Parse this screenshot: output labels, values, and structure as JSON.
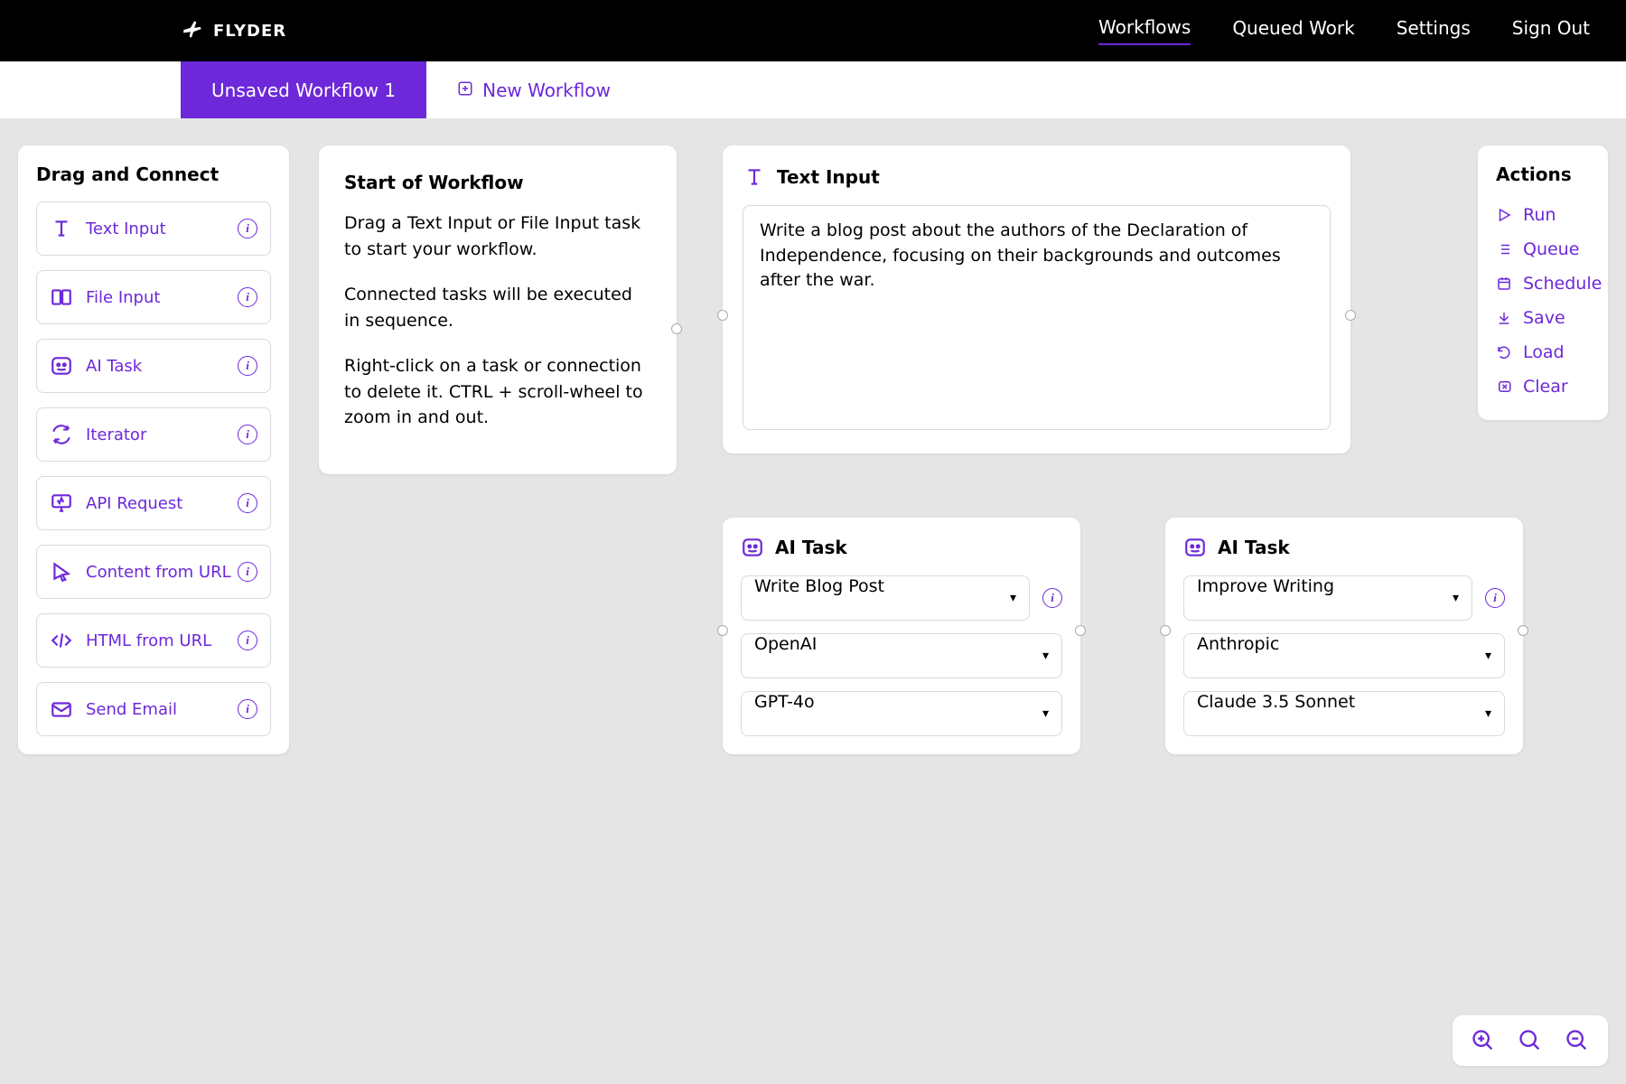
{
  "brand": "FLYDER",
  "nav": {
    "items": [
      "Workflows",
      "Queued Work",
      "Settings",
      "Sign Out"
    ],
    "active": 0
  },
  "tabs": {
    "active_label": "Unsaved Workflow 1",
    "new_label": "New Workflow"
  },
  "palette": {
    "title": "Drag and Connect",
    "items": [
      {
        "icon": "text-input-icon",
        "label": "Text Input"
      },
      {
        "icon": "file-input-icon",
        "label": "File Input"
      },
      {
        "icon": "ai-task-icon",
        "label": "AI Task"
      },
      {
        "icon": "iterator-icon",
        "label": "Iterator"
      },
      {
        "icon": "api-request-icon",
        "label": "API Request"
      },
      {
        "icon": "content-url-icon",
        "label": "Content from URL"
      },
      {
        "icon": "html-url-icon",
        "label": "HTML from URL"
      },
      {
        "icon": "send-email-icon",
        "label": "Send Email"
      }
    ]
  },
  "start_node": {
    "title": "Start of Workflow",
    "p1": "Drag a Text Input or File Input task to start your workflow.",
    "p2": "Connected tasks will be executed in sequence.",
    "p3": "Right-click on a task or connection to delete it. CTRL + scroll-wheel to zoom in and out."
  },
  "text_node": {
    "title": "Text Input",
    "value": "Write a blog post about the authors of the Declaration of Independence, focusing on their backgrounds and outcomes after the war."
  },
  "ai_node_1": {
    "title": "AI Task",
    "task": "Write Blog Post",
    "provider": "OpenAI",
    "model": "GPT-4o"
  },
  "ai_node_2": {
    "title": "AI Task",
    "task": "Improve Writing",
    "provider": "Anthropic",
    "model": "Claude 3.5 Sonnet"
  },
  "actions": {
    "title": "Actions",
    "items": [
      "Run",
      "Queue",
      "Schedule",
      "Save",
      "Load",
      "Clear"
    ]
  },
  "colors": {
    "accent": "#6d28d9"
  }
}
